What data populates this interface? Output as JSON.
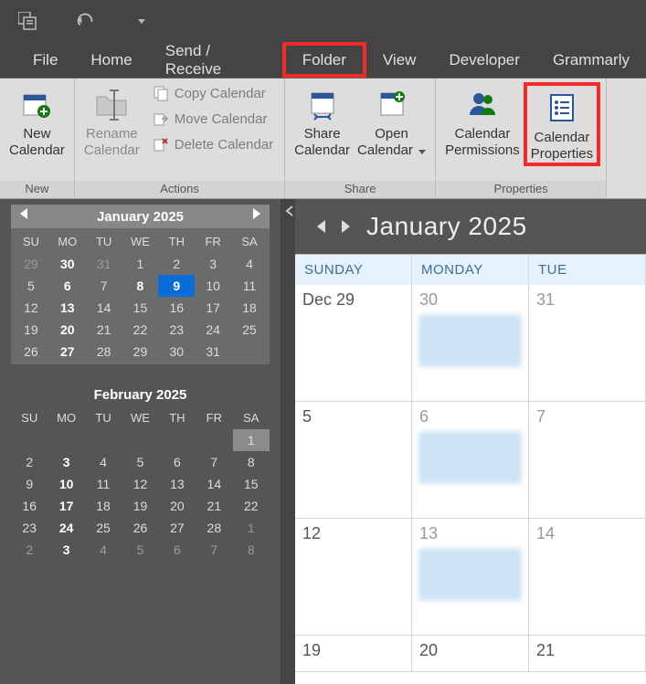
{
  "qat": {
    "icons": [
      "app-icon",
      "undo-icon",
      "customize-dropdown"
    ]
  },
  "tabs": [
    {
      "label": "File"
    },
    {
      "label": "Home"
    },
    {
      "label": "Send / Receive"
    },
    {
      "label": "Folder",
      "selected": true
    },
    {
      "label": "View"
    },
    {
      "label": "Developer"
    },
    {
      "label": "Grammarly"
    }
  ],
  "ribbon": {
    "groups": [
      {
        "label": "New",
        "items": [
          {
            "kind": "big",
            "label1": "New",
            "label2": "Calendar",
            "icon": "calendar-new-icon"
          }
        ]
      },
      {
        "label": "Actions",
        "items": [
          {
            "kind": "big",
            "label1": "Rename",
            "label2": "Calendar",
            "icon": "folder-rename-icon",
            "disabled": true
          },
          {
            "kind": "list",
            "rows": [
              {
                "label": "Copy Calendar",
                "icon": "copy-icon"
              },
              {
                "label": "Move Calendar",
                "icon": "move-icon"
              },
              {
                "label": "Delete Calendar",
                "icon": "delete-icon"
              }
            ]
          }
        ]
      },
      {
        "label": "Share",
        "items": [
          {
            "kind": "big",
            "label1": "Share",
            "label2": "Calendar",
            "icon": "calendar-share-icon"
          },
          {
            "kind": "big",
            "label1": "Open",
            "label2": "Calendar",
            "icon": "calendar-open-icon",
            "dropdown": true
          }
        ]
      },
      {
        "label": "Properties",
        "items": [
          {
            "kind": "big",
            "label1": "Calendar",
            "label2": "Permissions",
            "icon": "people-icon"
          },
          {
            "kind": "big",
            "label1": "Calendar",
            "label2": "Properties",
            "icon": "properties-icon",
            "highlight": true
          }
        ]
      }
    ]
  },
  "minical1": {
    "title": "January 2025",
    "dow": [
      "SU",
      "MO",
      "TU",
      "WE",
      "TH",
      "FR",
      "SA"
    ],
    "weeks": [
      [
        {
          "n": "29",
          "o": true
        },
        {
          "n": "30",
          "o": true,
          "b": true
        },
        {
          "n": "31",
          "o": true
        },
        {
          "n": "1"
        },
        {
          "n": "2"
        },
        {
          "n": "3"
        },
        {
          "n": "4"
        }
      ],
      [
        {
          "n": "5"
        },
        {
          "n": "6",
          "b": true
        },
        {
          "n": "7"
        },
        {
          "n": "8",
          "b": true
        },
        {
          "n": "9",
          "sel": true
        },
        {
          "n": "10"
        },
        {
          "n": "11"
        }
      ],
      [
        {
          "n": "12"
        },
        {
          "n": "13",
          "b": true
        },
        {
          "n": "14"
        },
        {
          "n": "15"
        },
        {
          "n": "16"
        },
        {
          "n": "17"
        },
        {
          "n": "18"
        }
      ],
      [
        {
          "n": "19"
        },
        {
          "n": "20",
          "b": true
        },
        {
          "n": "21"
        },
        {
          "n": "22"
        },
        {
          "n": "23"
        },
        {
          "n": "24"
        },
        {
          "n": "25"
        }
      ],
      [
        {
          "n": "26"
        },
        {
          "n": "27",
          "b": true
        },
        {
          "n": "28"
        },
        {
          "n": "29"
        },
        {
          "n": "30"
        },
        {
          "n": "31"
        },
        {
          "n": "",
          "o": true
        }
      ]
    ]
  },
  "minical2": {
    "title": "February 2025",
    "dow": [
      "SU",
      "MO",
      "TU",
      "WE",
      "TH",
      "FR",
      "SA"
    ],
    "weeks": [
      [
        {
          "n": ""
        },
        {
          "n": ""
        },
        {
          "n": ""
        },
        {
          "n": ""
        },
        {
          "n": ""
        },
        {
          "n": ""
        },
        {
          "n": "1",
          "box": true
        }
      ],
      [
        {
          "n": "2"
        },
        {
          "n": "3",
          "b": true
        },
        {
          "n": "4"
        },
        {
          "n": "5"
        },
        {
          "n": "6"
        },
        {
          "n": "7"
        },
        {
          "n": "8"
        }
      ],
      [
        {
          "n": "9"
        },
        {
          "n": "10",
          "b": true
        },
        {
          "n": "11"
        },
        {
          "n": "12"
        },
        {
          "n": "13"
        },
        {
          "n": "14"
        },
        {
          "n": "15"
        }
      ],
      [
        {
          "n": "16"
        },
        {
          "n": "17",
          "b": true
        },
        {
          "n": "18"
        },
        {
          "n": "19"
        },
        {
          "n": "20"
        },
        {
          "n": "21"
        },
        {
          "n": "22"
        }
      ],
      [
        {
          "n": "23"
        },
        {
          "n": "24",
          "b": true
        },
        {
          "n": "25"
        },
        {
          "n": "26"
        },
        {
          "n": "27"
        },
        {
          "n": "28"
        },
        {
          "n": "1",
          "o": true
        }
      ],
      [
        {
          "n": "2",
          "o": true
        },
        {
          "n": "3",
          "o": true,
          "b": true
        },
        {
          "n": "4",
          "o": true
        },
        {
          "n": "5",
          "o": true
        },
        {
          "n": "6",
          "o": true
        },
        {
          "n": "7",
          "o": true
        },
        {
          "n": "8",
          "o": true
        }
      ]
    ]
  },
  "calview": {
    "title": "January 2025",
    "dow": [
      "SUNDAY",
      "MONDAY",
      "TUE"
    ],
    "weeks": [
      [
        {
          "label": "Dec 29"
        },
        {
          "label": "30",
          "appt": true,
          "gray": true
        },
        {
          "label": "31",
          "gray": true
        }
      ],
      [
        {
          "label": "5"
        },
        {
          "label": "6",
          "appt": true,
          "gray": true
        },
        {
          "label": "7",
          "gray": true
        }
      ],
      [
        {
          "label": "12"
        },
        {
          "label": "13",
          "appt": true,
          "gray": true
        },
        {
          "label": "14",
          "gray": true
        }
      ],
      [
        {
          "label": "19"
        },
        {
          "label": "20"
        },
        {
          "label": "21"
        }
      ]
    ]
  }
}
